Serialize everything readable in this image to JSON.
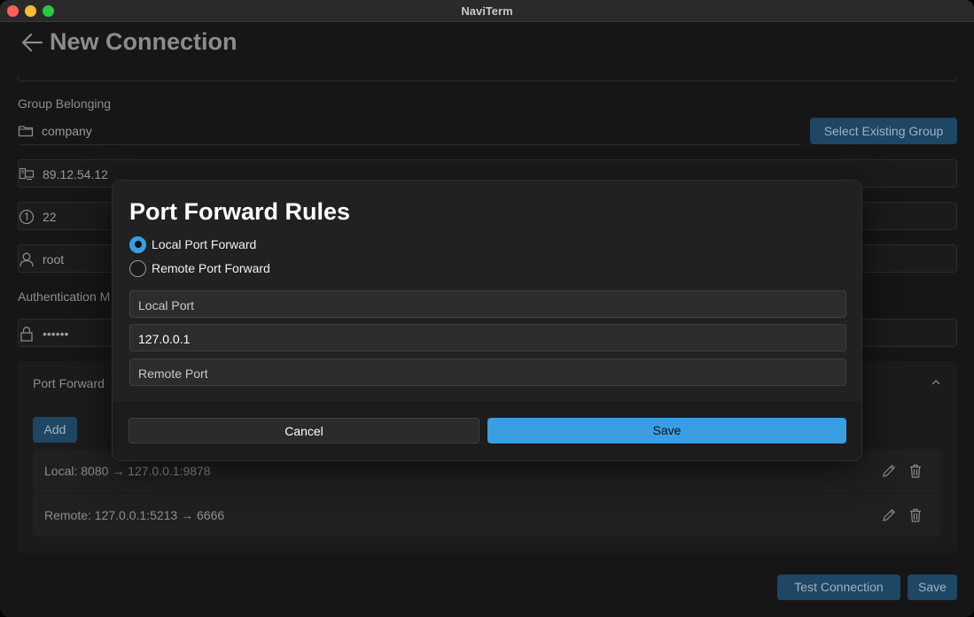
{
  "window": {
    "title": "NaviTerm"
  },
  "page": {
    "title": "New Connection",
    "group_label": "Group Belonging",
    "group_value": "company",
    "select_group_button": "Select Existing Group",
    "host_value": "89.12.54.12",
    "port_value": "22",
    "user_value": "root",
    "auth_label": "Authentication M",
    "password_value": "••••••",
    "port_forward": {
      "title": "Port Forward",
      "add_button": "Add",
      "rules": [
        {
          "text": "Local: 8080 → 127.0.0.1:9878"
        },
        {
          "text": "Remote: 127.0.0.1:5213 → 6666"
        }
      ]
    },
    "test_connection_button": "Test Connection",
    "save_button": "Save"
  },
  "modal": {
    "title": "Port Forward Rules",
    "options": [
      {
        "label": "Local Port Forward",
        "checked": true
      },
      {
        "label": "Remote Port Forward",
        "checked": false
      }
    ],
    "local_port_placeholder": "Local Port",
    "host_value": "127.0.0.1",
    "remote_port_placeholder": "Remote Port",
    "cancel_button": "Cancel",
    "save_button": "Save"
  },
  "colors": {
    "accent": "#3b9ee3",
    "accent_dim": "#1e4665",
    "background": "#161616",
    "modal": "#212121"
  },
  "icons": [
    "back-arrow-icon",
    "folder-icon",
    "host-icon",
    "port-icon",
    "user-icon",
    "lock-icon",
    "chevron-up-icon",
    "edit-icon",
    "trash-icon"
  ]
}
